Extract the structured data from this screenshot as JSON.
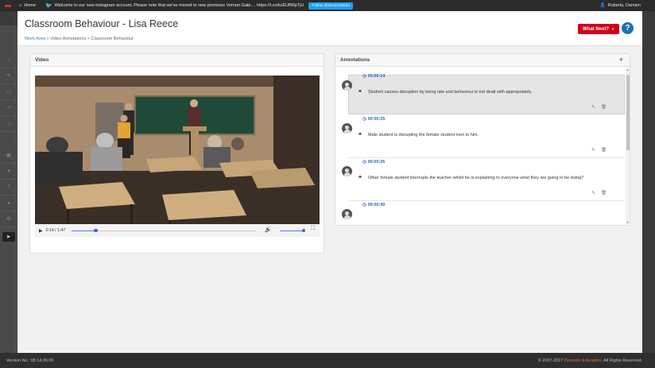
{
  "topbar": {
    "home_label": "Home",
    "twitter_message": "Welcome to our new instagram account. Please note that we've moved to new premises Vernon Gate.... https://t.co/kcEUBRpTjU",
    "follow_label": "Follow @DeventioEdu",
    "user_name": "Roberts, Damien"
  },
  "page": {
    "title": "Classroom Behaviour - Lisa Reece",
    "breadcrumb": [
      "Work Area",
      "Video Annotations",
      "Classroom Behaviour"
    ],
    "breadcrumb_sep": "»",
    "what_next_label": "What Next?",
    "help_label": "?"
  },
  "video_panel": {
    "title": "Video",
    "current_time": "0:14",
    "duration": "1:47",
    "progress_fraction": 0.131,
    "volume_fraction": 1.0
  },
  "annotations_panel": {
    "title": "Annotations",
    "add_label": "+",
    "items": [
      {
        "time": "00:00:14",
        "text": "Student causes disruption by being late and behaviour is not dealt with appropriately.",
        "selected": true
      },
      {
        "time": "00:00:25",
        "text": "Male student is disrupting the female student next to him.",
        "selected": false
      },
      {
        "time": "00:00:26",
        "text": "Other female student interrupts the teacher whilst he is explaining to everyone what they are going to be doing?",
        "selected": false
      },
      {
        "time": "00:00:40",
        "text": "",
        "selected": false
      }
    ]
  },
  "footer": {
    "version": "Version No.: 08.14.00.00",
    "copyright_prefix": "© 2007-2017",
    "company": "Deventio Education",
    "copyright_suffix": ". All Rights Reserved."
  },
  "colors": {
    "accent_red": "#d0021b",
    "link_blue": "#2a69b0",
    "twitter_blue": "#1da1f2",
    "company_orange": "#e8663c"
  },
  "icons": {
    "sidebar": [
      "home-icon",
      "pencil-icon",
      "inbox-icon",
      "check-icon",
      "tag-icon",
      "grid-icon",
      "wrench-icon",
      "question-icon",
      "comment-icon",
      "gear-icon",
      "play-icon"
    ]
  }
}
